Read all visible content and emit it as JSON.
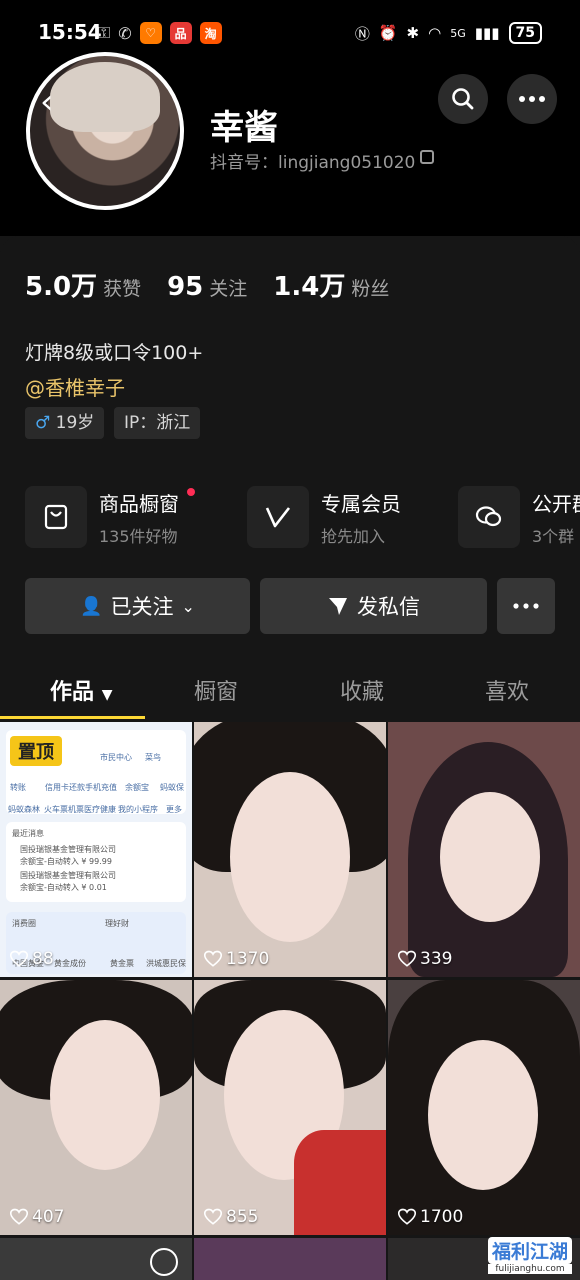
{
  "status_bar": {
    "time": "15:54",
    "apps": [
      {
        "label": "♡",
        "color": "#ff7a00"
      },
      {
        "label": "品",
        "color": "#e53935"
      },
      {
        "label": "淘",
        "color": "#ff5500"
      }
    ],
    "network": "5G",
    "battery": "75"
  },
  "profile": {
    "name": "幸酱",
    "id_label": "抖音号：lingjiang051020",
    "stats": [
      {
        "value": "5.0万",
        "label": "获赞"
      },
      {
        "value": "95",
        "label": "关注"
      },
      {
        "value": "1.4万",
        "label": "粉丝"
      }
    ],
    "bio": "灯牌8级或口令100+",
    "mention": "@香椎幸子",
    "gender_symbol": "♂",
    "age": "19岁",
    "ip": "IP：浙江"
  },
  "features": [
    {
      "title": "商品橱窗",
      "sub": "135件好物"
    },
    {
      "title": "专属会员",
      "sub": "抢先加入"
    },
    {
      "title": "公开群",
      "sub": "3个群"
    }
  ],
  "actions": {
    "follow": "已关注",
    "message": "发私信"
  },
  "tabs": [
    {
      "label": "作品"
    },
    {
      "label": "橱窗"
    },
    {
      "label": "收藏"
    },
    {
      "label": "喜欢"
    }
  ],
  "videos": [
    {
      "likes": "88",
      "pinned_label": "置顶"
    },
    {
      "likes": "1370"
    },
    {
      "likes": "339"
    },
    {
      "likes": "407"
    },
    {
      "likes": "855"
    },
    {
      "likes": "1700"
    }
  ],
  "pinned_preview": {
    "apps": [
      "市民中心",
      "菜鸟",
      "转账",
      "信用卡还款",
      "手机充值",
      "余额宝",
      "蚂蚁保",
      "蚂蚁森林",
      "火车票机票",
      "医疗健康",
      "我的小程序",
      "更多"
    ],
    "section": "最近消息",
    "messages": [
      "国投瑞银基金管理有限公司",
      "余额宝-自动转入 ¥ 99.99",
      "国投瑞银基金管理有限公司",
      "余额宝-自动转入 ¥ 0.01"
    ],
    "cards": [
      "消费圈",
      "理好财",
      "中国黄金",
      "黄金成份",
      "黄金票",
      "洪城惠民保"
    ]
  },
  "watermark": {
    "main": "福利江湖",
    "sub": "fulijianghu.com"
  }
}
